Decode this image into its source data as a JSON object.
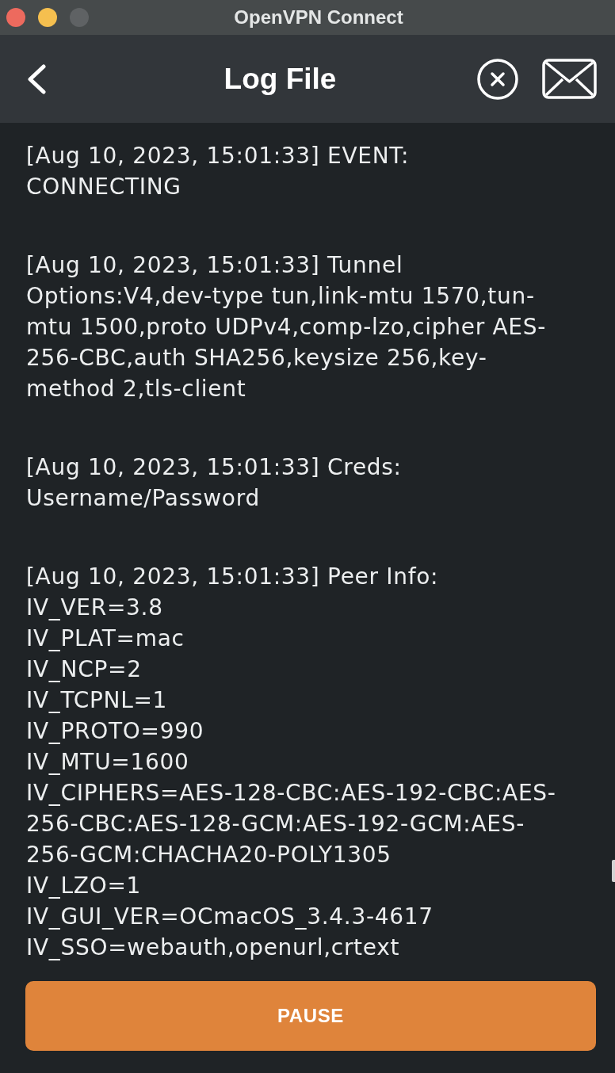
{
  "window": {
    "title": "OpenVPN Connect"
  },
  "header": {
    "title": "Log File"
  },
  "log": {
    "entries": [
      {
        "text": "[Aug 10, 2023, 15:01:33] EVENT: CONNECTING"
      },
      {
        "text": "[Aug 10, 2023, 15:01:33] Tunnel Options:V4,dev-type tun,link-mtu 1570,tun-mtu 1500,proto UDPv4,comp-lzo,cipher AES-256-CBC,auth SHA256,keysize 256,key-method 2,tls-client"
      },
      {
        "text": "[Aug 10, 2023, 15:01:33] Creds: Username/Password"
      },
      {
        "text": "[Aug 10, 2023, 15:01:33] Peer Info:",
        "lines": [
          "IV_VER=3.8",
          "IV_PLAT=mac",
          "IV_NCP=2",
          "IV_TCPNL=1",
          "IV_PROTO=990",
          "IV_MTU=1600",
          "IV_CIPHERS=AES-128-CBC:AES-192-CBC:AES-256-CBC:AES-128-GCM:AES-192-GCM:AES-256-GCM:CHACHA20-POLY1305",
          "IV_LZO=1",
          "IV_GUI_VER=OCmacOS_3.4.3-4617",
          "IV_SSO=webauth,openurl,crtext"
        ]
      }
    ]
  },
  "buttons": [
    {
      "label": "PAUSE"
    }
  ]
}
